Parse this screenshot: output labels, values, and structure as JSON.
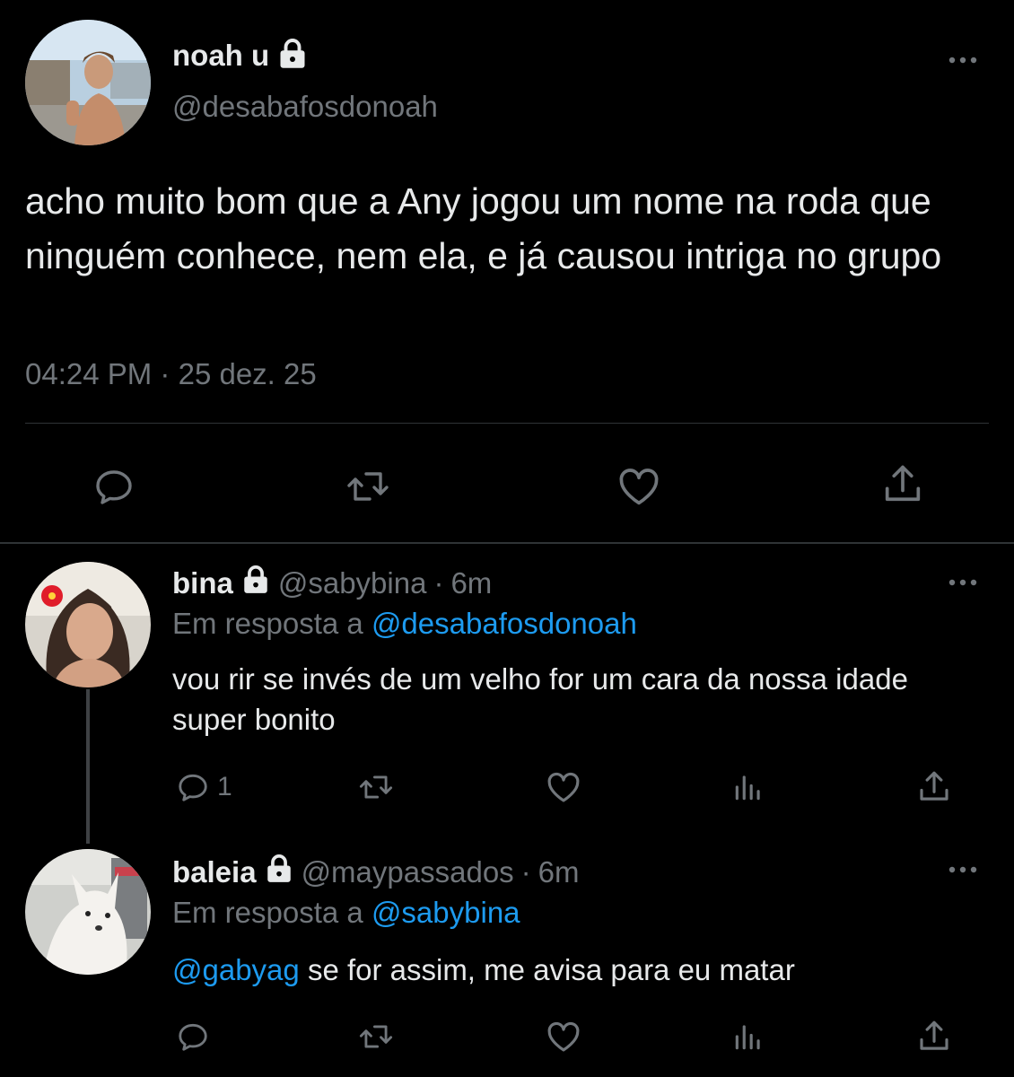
{
  "main_tweet": {
    "display_name": "noah u",
    "handle": "@desabafosdonoah",
    "text": "acho muito bom que a Any jogou um nome na roda que ninguém conhece, nem ela, e já causou intriga no grupo",
    "time": "04:24 PM",
    "separator": "·",
    "date": "25 dez. 25",
    "actions": [
      "reply-icon",
      "retweet-icon",
      "like-icon",
      "share-icon"
    ]
  },
  "replies": [
    {
      "display_name": "bina",
      "handle": "@sabybina",
      "separator": "·",
      "age": "6m",
      "reply_prefix": "Em resposta a",
      "reply_to": "@desabafosdonoah",
      "text": "vou rir se invés de um velho for um cara da nossa idade super bonito",
      "reply_count": "1"
    },
    {
      "display_name": "baleia",
      "handle": "@maypassados",
      "separator": "·",
      "age": "6m",
      "reply_prefix": "Em resposta a",
      "reply_to": "@sabybina",
      "mention": "@gabyag",
      "text": "se for assim, me avisa para eu matar",
      "reply_count": ""
    }
  ],
  "colors": {
    "background": "#000000",
    "text": "#e7e9ea",
    "muted": "#71767b",
    "link": "#1d9bf0",
    "divider": "#2f3336"
  }
}
